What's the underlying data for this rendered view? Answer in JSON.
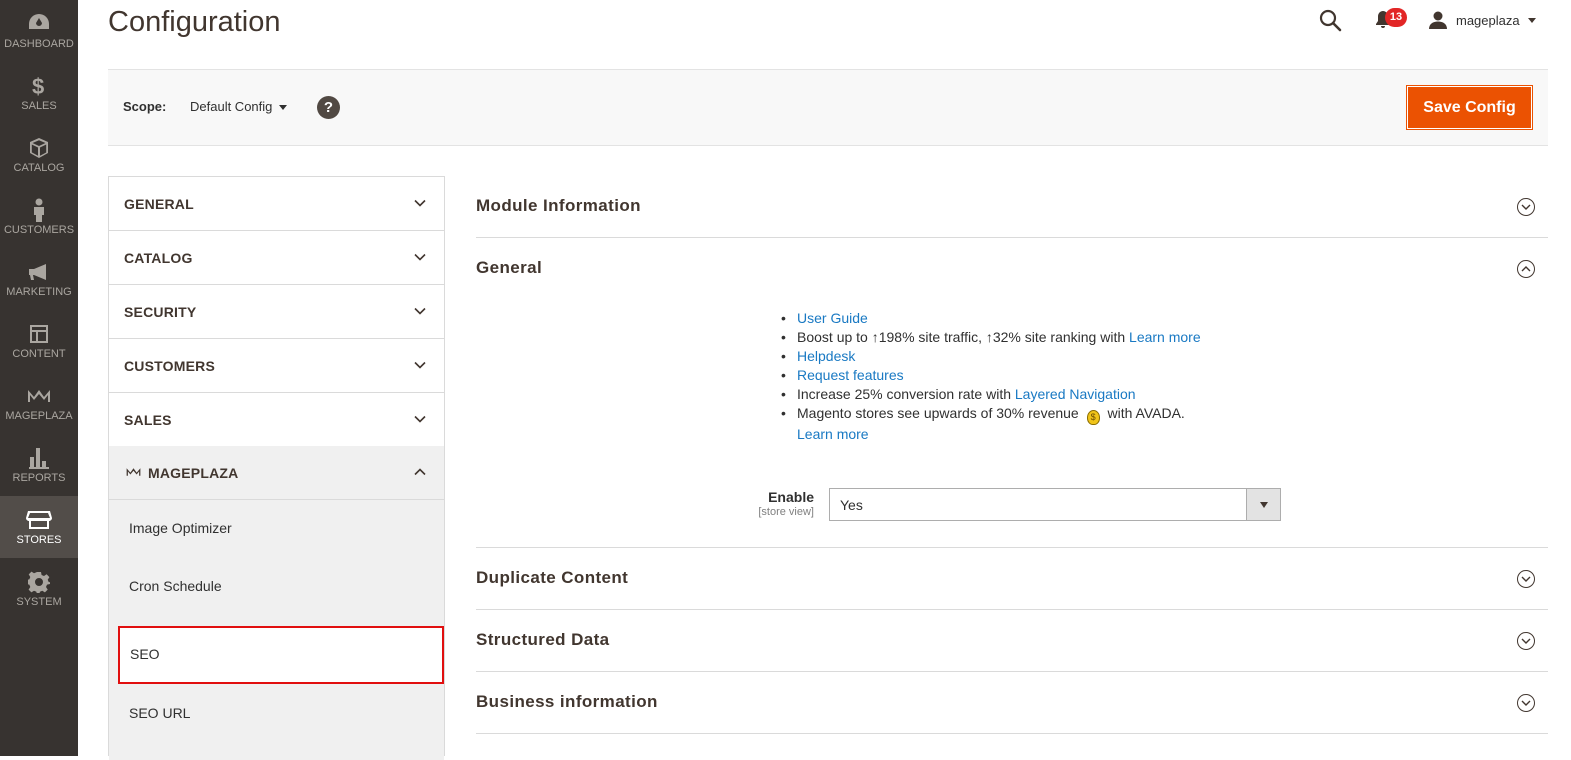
{
  "menu": {
    "items": [
      {
        "label": "DASHBOARD",
        "icon": "dashboard-icon"
      },
      {
        "label": "SALES",
        "icon": "dollar-icon"
      },
      {
        "label": "CATALOG",
        "icon": "cube-icon"
      },
      {
        "label": "CUSTOMERS",
        "icon": "person-icon"
      },
      {
        "label": "MARKETING",
        "icon": "megaphone-icon"
      },
      {
        "label": "CONTENT",
        "icon": "layout-icon"
      },
      {
        "label": "MAGEPLAZA",
        "icon": "mageplaza-logo-icon"
      },
      {
        "label": "REPORTS",
        "icon": "bar-chart-icon"
      },
      {
        "label": "STORES",
        "icon": "store-icon"
      },
      {
        "label": "SYSTEM",
        "icon": "gear-icon"
      }
    ],
    "active": "STORES"
  },
  "header": {
    "title": "Configuration",
    "notifications_count": "13",
    "user_name": "mageplaza"
  },
  "scope": {
    "label": "Scope:",
    "value": "Default Config",
    "help": "?",
    "save_label": "Save Config"
  },
  "tabs": {
    "general": "GENERAL",
    "catalog": "CATALOG",
    "security": "SECURITY",
    "customers": "CUSTOMERS",
    "sales": "SALES",
    "mageplaza": "MAGEPLAZA",
    "sub_items": [
      "Image Optimizer",
      "Cron Schedule",
      "SEO",
      "SEO URL"
    ],
    "active_sub": "SEO"
  },
  "sections": {
    "module_info": "Module Information",
    "general": "General",
    "duplicate": "Duplicate Content",
    "structured": "Structured Data",
    "business": "Business information"
  },
  "general_info": {
    "user_guide": "User Guide",
    "boost_text": "Boost up to ↑198% site traffic, ↑32% site ranking with ",
    "learn_more_1": "Learn more",
    "helpdesk": "Helpdesk",
    "request_features": "Request features",
    "conversion_text": "Increase 25% conversion rate with ",
    "layered_nav": "Layered Navigation",
    "revenue_text_1": "Magento stores see upwards of 30% revenue ",
    "revenue_text_2": " with AVADA.",
    "learn_more_2": "Learn more"
  },
  "enable_field": {
    "label": "Enable",
    "scope": "[store view]",
    "value": "Yes"
  },
  "colors": {
    "sidebar_bg": "#373330",
    "accent": "#eb5202",
    "link": "#1979c3",
    "highlight_border": "#e10f0f"
  }
}
